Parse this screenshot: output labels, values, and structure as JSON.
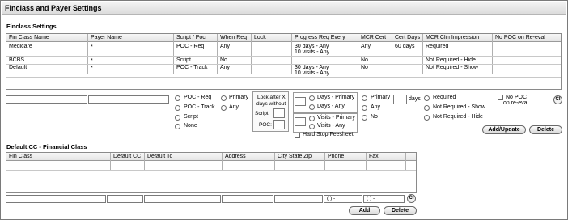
{
  "window": {
    "title": "Finclass and Payer Settings"
  },
  "finclass_section": {
    "title": "Finclass Settings",
    "columns": [
      "Fin Class Name",
      "Payer Name",
      "Script / Poc",
      "When Req",
      "Lock",
      "Progress Req Every",
      "MCR Cert",
      "Cert Days",
      "MCR Clin Impression",
      "No POC on Re-eval"
    ],
    "rows": [
      {
        "fin_class": "Medicare",
        "payer": "*",
        "script_poc": "POC - Req",
        "when_req": "Any",
        "lock": "",
        "progress_1": "30 days - Any",
        "progress_2": "10 visits - Any",
        "mcr_cert": "Any",
        "cert_days": "60 days",
        "clin_impression": "Required",
        "no_poc": ""
      },
      {
        "fin_class": "BCBS",
        "payer": "*",
        "script_poc": "Script",
        "when_req": "No",
        "lock": "",
        "progress_1": "",
        "progress_2": "",
        "mcr_cert": "No",
        "cert_days": "",
        "clin_impression": "Not Required - Hide",
        "no_poc": ""
      },
      {
        "fin_class": "Default",
        "payer": "*",
        "script_poc": "POC - Track",
        "when_req": "Any",
        "lock": "",
        "progress_1": "30 days - Any",
        "progress_2": "10 visits - Any",
        "mcr_cert": "No",
        "cert_days": "",
        "clin_impression": "Not Required - Show",
        "no_poc": ""
      }
    ],
    "fin_class_input": "",
    "payer_input": "",
    "script_options": [
      "POC - Req",
      "POC - Track",
      "Script",
      "None"
    ],
    "when_options": [
      "Primary",
      "Any"
    ],
    "lock_label_1": "Lock after X",
    "lock_label_2": "days without",
    "lock_script_label": "Script:",
    "lock_poc_label": "POC:",
    "days_options": [
      "Days - Primary",
      "Days - Any"
    ],
    "visits_options": [
      "Visits - Primary",
      "Visits - Any"
    ],
    "hard_stop_label": "Hard Stop Feesheet",
    "mcr_options": [
      "Primary",
      "Any",
      "No"
    ],
    "days_unit": "days",
    "clin_options": [
      "Required",
      "Not Required - Show",
      "Not Required - Hide"
    ],
    "no_poc_label_1": "No POC",
    "no_poc_label_2": "on re-eval",
    "clear_label": "Cl",
    "add_update_label": "Add/Update",
    "delete_label": "Delete"
  },
  "default_cc_section": {
    "title": "Default CC - Financial Class",
    "columns": [
      "Fin Class",
      "Default CC",
      "Default To",
      "Address",
      "City State Zip",
      "Phone",
      "Fax"
    ],
    "phone_placeholder": "(   )   -",
    "fax_placeholder": "(   )   -",
    "clear_label": "Cl",
    "add_label": "Add",
    "delete_label": "Delete"
  }
}
